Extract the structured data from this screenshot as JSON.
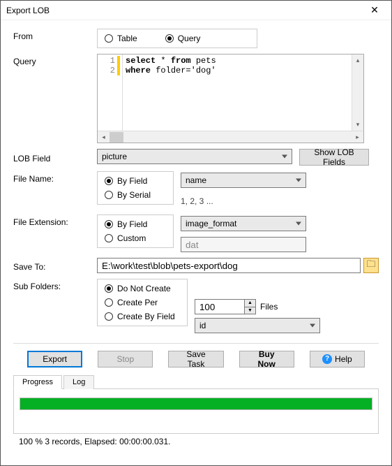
{
  "window": {
    "title": "Export LOB"
  },
  "from": {
    "label": "From",
    "options": {
      "table": "Table",
      "query": "Query"
    },
    "selected": "query"
  },
  "query": {
    "label": "Query",
    "lines": [
      {
        "n": 1,
        "text_html": "<span class='kw'>select</span> * <span class='kw'>from</span> pets"
      },
      {
        "n": 2,
        "text_html": "<span class='kw'>where</span> folder=<span class='str'>'dog'</span>"
      }
    ],
    "raw": "select * from pets\nwhere folder='dog'"
  },
  "lob_field": {
    "label": "LOB Field",
    "value": "picture",
    "show_button": "Show LOB Fields"
  },
  "file_name": {
    "label": "File Name:",
    "options": {
      "by_field": "By Field",
      "by_serial": "By Serial"
    },
    "selected": "by_field",
    "field_value": "name",
    "serial_hint": "1, 2, 3 ..."
  },
  "file_ext": {
    "label": "File Extension:",
    "options": {
      "by_field": "By Field",
      "custom": "Custom"
    },
    "selected": "by_field",
    "field_value": "image_format",
    "custom_value": "dat"
  },
  "save_to": {
    "label": "Save To:",
    "path": "E:\\work\\test\\blob\\pets-export\\dog"
  },
  "sub_folders": {
    "label": "Sub Folders:",
    "options": {
      "none": "Do Not Create",
      "per": "Create Per",
      "by_field": "Create By Field"
    },
    "selected": "none",
    "per_count": "100",
    "per_unit": "Files",
    "field_value": "id"
  },
  "buttons": {
    "export": "Export",
    "stop": "Stop",
    "save_task": "Save Task",
    "buy_now": "Buy Now",
    "help": "Help"
  },
  "tabs": {
    "progress": "Progress",
    "log": "Log",
    "active": "progress"
  },
  "progress": {
    "percent": 100,
    "status": "100 %      3 records,    Elapsed: 00:00:00.031."
  },
  "colors": {
    "progress_fill": "#06b025",
    "accent_border": "#0078d7"
  }
}
